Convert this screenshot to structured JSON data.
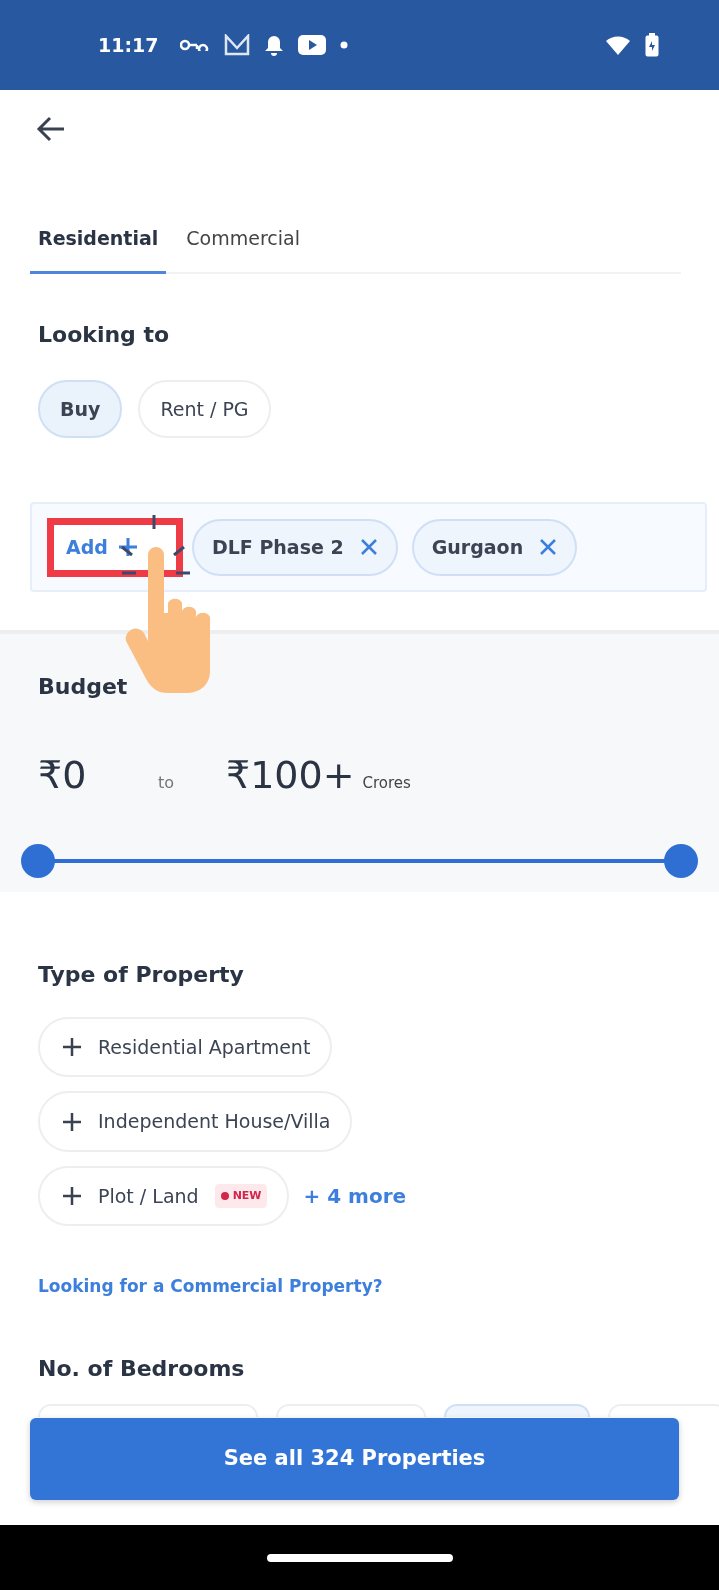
{
  "status_bar": {
    "time": "11:17"
  },
  "tabs": [
    {
      "label": "Residential",
      "selected": true
    },
    {
      "label": "Commercial",
      "selected": false
    }
  ],
  "looking_to": {
    "title": "Looking to",
    "options": [
      {
        "label": "Buy",
        "selected": true
      },
      {
        "label": "Rent / PG",
        "selected": false
      }
    ]
  },
  "locations": {
    "add_label": "Add",
    "highlighted": true,
    "chips": [
      {
        "label": "DLF Phase 2"
      },
      {
        "label": "Gurgaon"
      }
    ]
  },
  "budget": {
    "title": "Budget",
    "min": "₹0",
    "separator": "to",
    "max": "₹100+",
    "unit": "Crores",
    "handles": [
      {
        "level": 0
      },
      {
        "level": 1
      }
    ]
  },
  "property_type": {
    "title": "Type of Property",
    "options": [
      {
        "label": "Residential Apartment"
      },
      {
        "label": "Independent House/Villa"
      },
      {
        "label": "Plot / Land",
        "badge": "NEW"
      }
    ],
    "more": "+ 4 more",
    "commercial_link": "Looking for a Commercial Property?"
  },
  "bedrooms": {
    "title": "No. of Bedrooms",
    "options": [
      {
        "selected": false
      },
      {
        "selected": false
      },
      {
        "selected": true
      },
      {
        "selected": false
      }
    ]
  },
  "cta": {
    "label": "See all 324 Properties"
  }
}
